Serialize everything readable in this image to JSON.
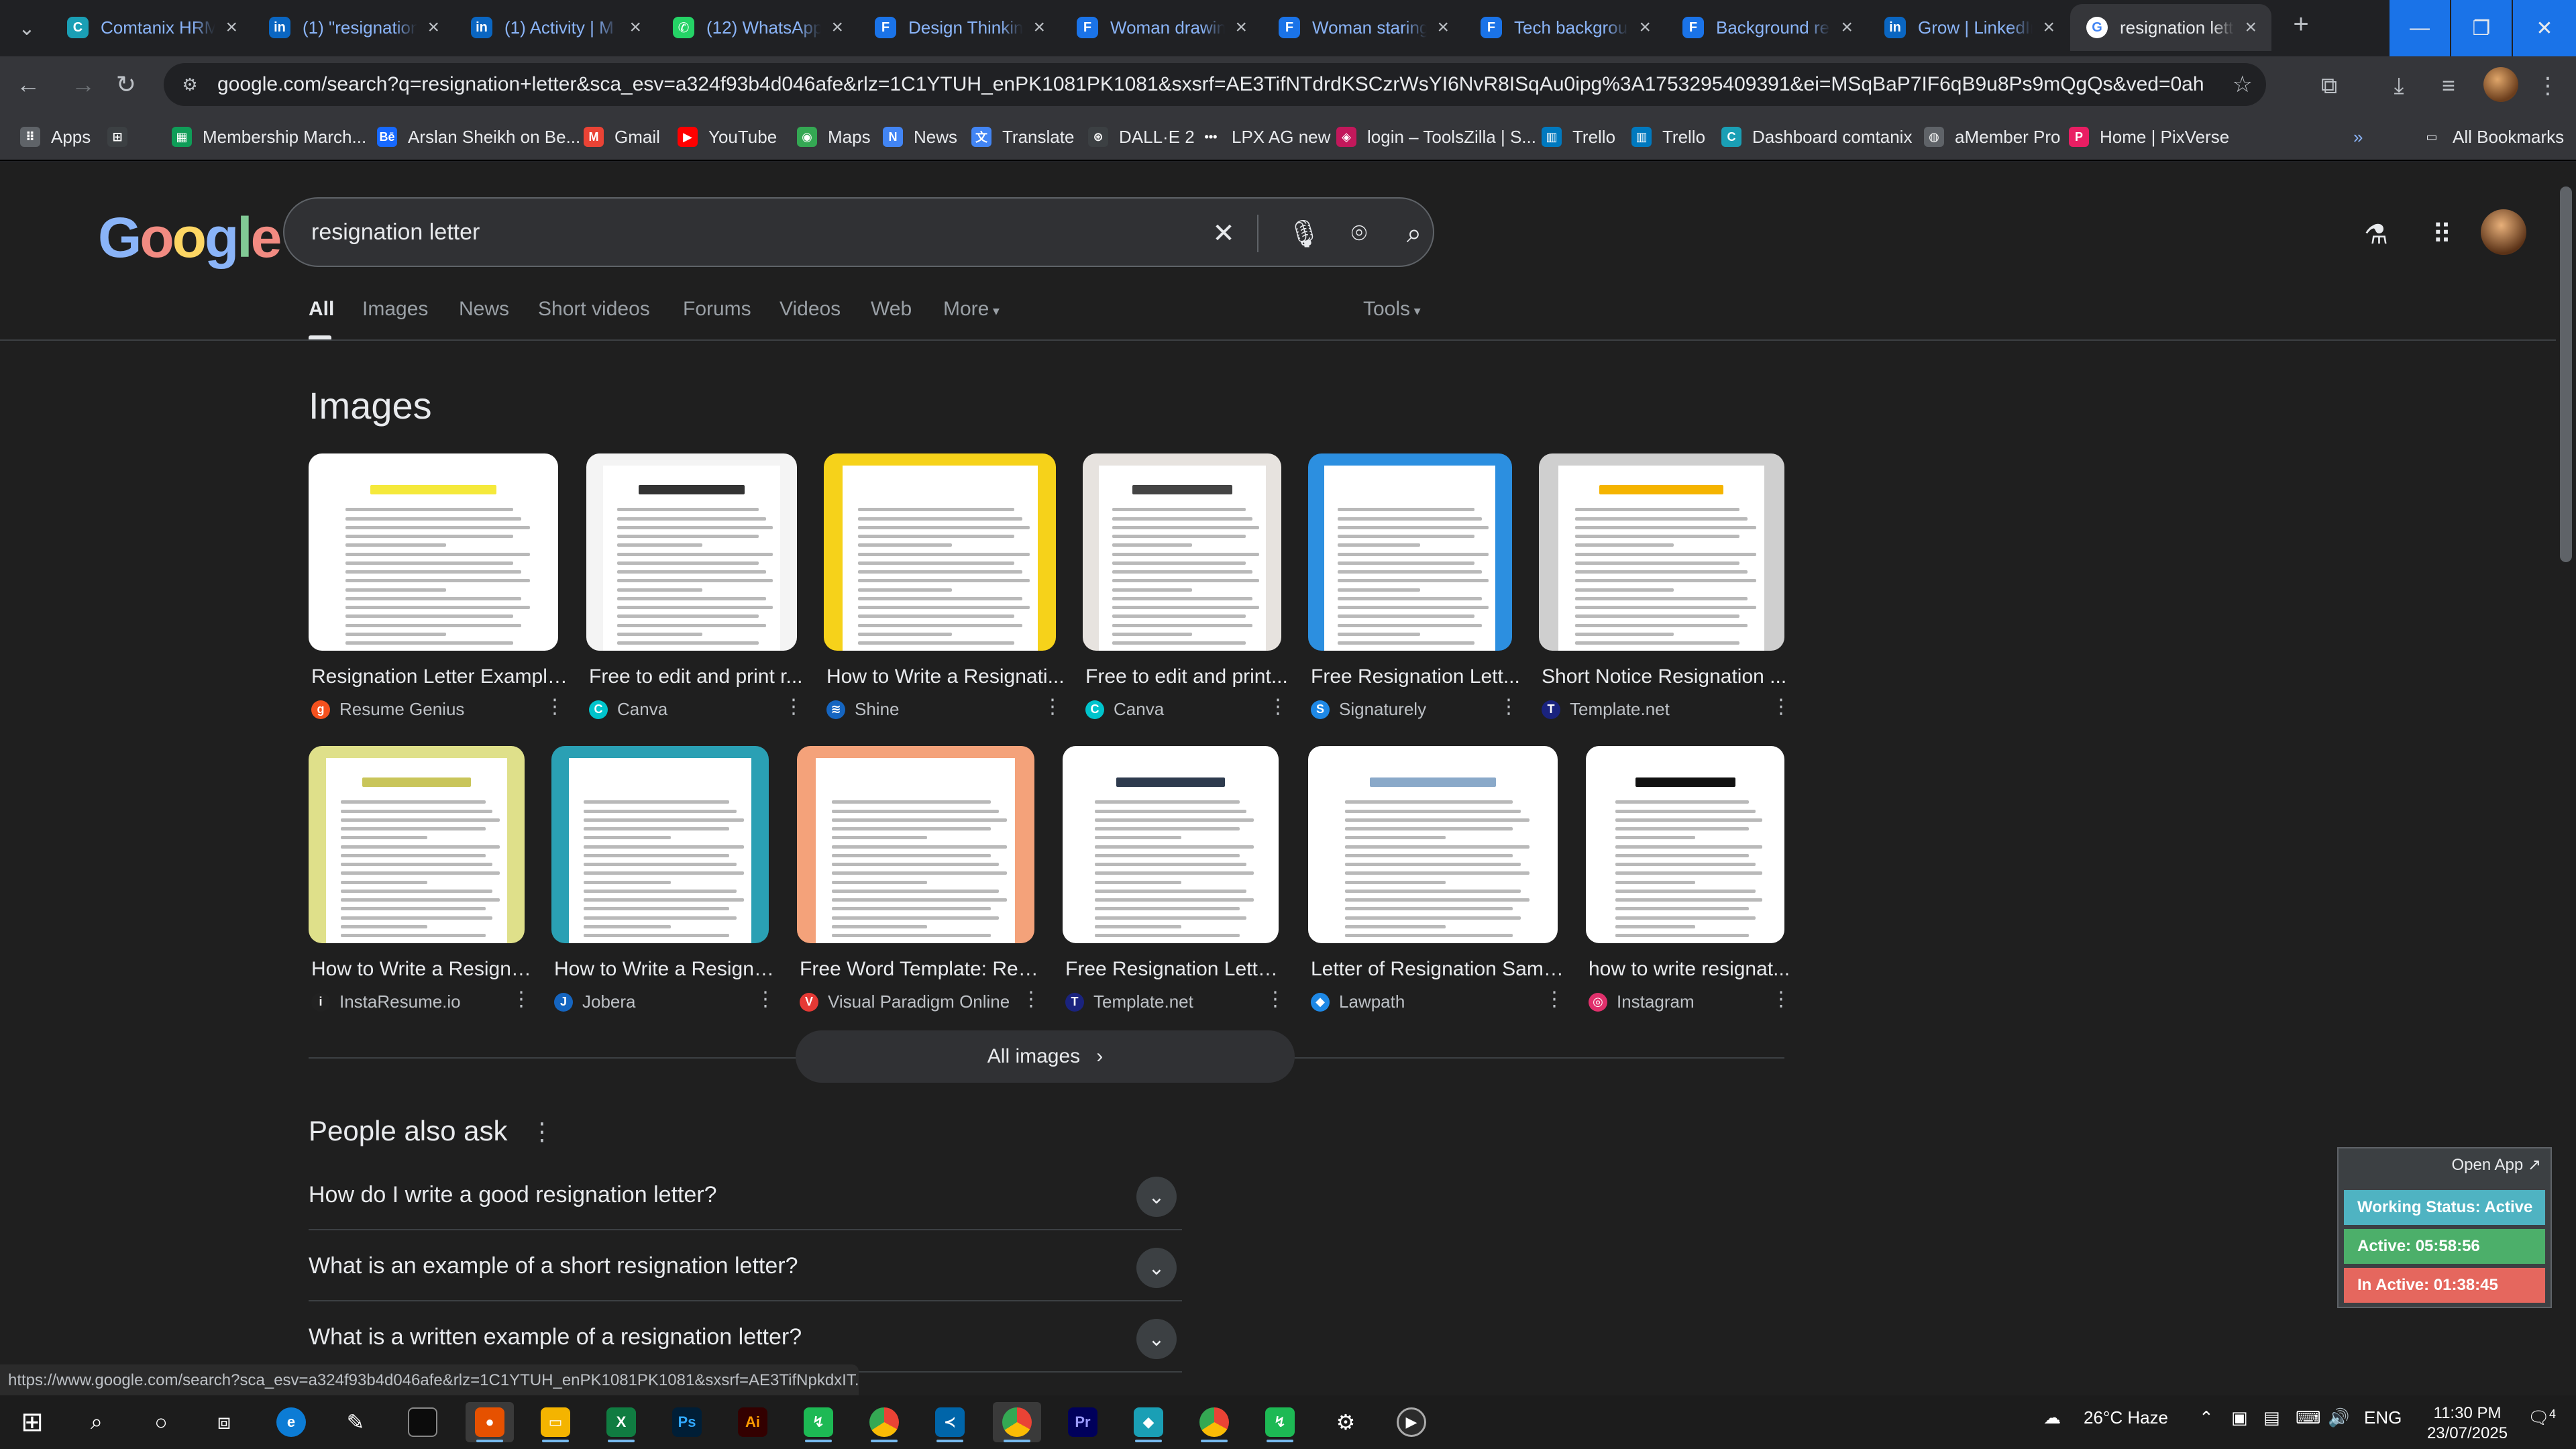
{
  "tabs": [
    {
      "title": "Comtanix HRM",
      "icon": "comtanix-icon",
      "color": "#1a9fb5",
      "glyph": "C"
    },
    {
      "title": "(1) \"resignation",
      "icon": "linkedin-icon",
      "color": "#0a66c2",
      "glyph": "in"
    },
    {
      "title": "(1) Activity | M",
      "icon": "linkedin-icon",
      "color": "#0a66c2",
      "glyph": "in"
    },
    {
      "title": "(12) WhatsApp",
      "icon": "whatsapp-icon",
      "color": "#25d366",
      "glyph": "✆"
    },
    {
      "title": "Design Thinkin",
      "icon": "framer-icon",
      "color": "#1a73e8",
      "glyph": "F"
    },
    {
      "title": "Woman drawin",
      "icon": "framer-icon",
      "color": "#1a73e8",
      "glyph": "F"
    },
    {
      "title": "Woman staring",
      "icon": "framer-icon",
      "color": "#1a73e8",
      "glyph": "F"
    },
    {
      "title": "Tech backgrou",
      "icon": "framer-icon",
      "color": "#1a73e8",
      "glyph": "F"
    },
    {
      "title": "Background re",
      "icon": "framer-icon",
      "color": "#1a73e8",
      "glyph": "F"
    },
    {
      "title": "Grow | LinkedIn",
      "icon": "linkedin-icon",
      "color": "#0a66c2",
      "glyph": "in"
    },
    {
      "title": "resignation lett",
      "icon": "google-icon",
      "color": "#ffffff",
      "glyph": "G",
      "active": true
    }
  ],
  "toolbar": {
    "url": "google.com/search?q=resignation+letter&sca_esv=a324f93b4d046afe&rlz=1C1YTUH_enPK1081PK1081&sxsrf=AE3TifNTdrdKSCzrWsYI6NvR8ISqAu0ipg%3A1753295409391&ei=MSqBaP7IF6qB9u8Ps9mQgQs&ved=0ahUKEwi-pcCwztOOAxWq..."
  },
  "bookmarks": [
    {
      "label": "Apps",
      "icon": "apps-grid-icon",
      "color": "#5f6368",
      "glyph": "⠿"
    },
    {
      "label": "",
      "icon": "grid-icon",
      "color": "#3c4043",
      "glyph": "⊞"
    },
    {
      "label": "Membership March...",
      "icon": "sheets-icon",
      "color": "#0f9d58",
      "glyph": "▦"
    },
    {
      "label": "Arslan Sheikh on Be...",
      "icon": "behance-icon",
      "color": "#1769ff",
      "glyph": "Bē"
    },
    {
      "label": "Gmail",
      "icon": "gmail-icon",
      "color": "#ea4335",
      "glyph": "M"
    },
    {
      "label": "YouTube",
      "icon": "youtube-icon",
      "color": "#ff0000",
      "glyph": "▶"
    },
    {
      "label": "Maps",
      "icon": "maps-icon",
      "color": "#34a853",
      "glyph": "◉"
    },
    {
      "label": "News",
      "icon": "news-icon",
      "color": "#4285f4",
      "glyph": "N"
    },
    {
      "label": "Translate",
      "icon": "translate-icon",
      "color": "#4285f4",
      "glyph": "文"
    },
    {
      "label": "DALL·E 2",
      "icon": "openai-icon",
      "color": "#3c4043",
      "glyph": "⊛"
    },
    {
      "label": "LPX AG new",
      "icon": "dots-icon",
      "color": "#35363a",
      "glyph": "•••"
    },
    {
      "label": "login – ToolsZilla | S...",
      "icon": "toolszilla-icon",
      "color": "#c2185b",
      "glyph": "◈"
    },
    {
      "label": "Trello",
      "icon": "trello-icon",
      "color": "#0079bf",
      "glyph": "▥"
    },
    {
      "label": "Trello",
      "icon": "trello-icon",
      "color": "#0079bf",
      "glyph": "▥"
    },
    {
      "label": "Dashboard comtanix",
      "icon": "comtanix-icon",
      "color": "#1a9fb5",
      "glyph": "C"
    },
    {
      "label": "aMember Pro",
      "icon": "globe-icon",
      "color": "#5f6368",
      "glyph": "◍"
    },
    {
      "label": "Home | PixVerse",
      "icon": "pixverse-icon",
      "color": "#e91e63",
      "glyph": "P"
    }
  ],
  "bookmarks_overflow": "»",
  "all_bookmarks": "All Bookmarks",
  "search": {
    "query": "resignation letter",
    "logo": [
      "G",
      "o",
      "o",
      "g",
      "l",
      "e"
    ]
  },
  "nav_tabs": [
    "All",
    "Images",
    "News",
    "Short videos",
    "Forums",
    "Videos",
    "Web",
    "More",
    "Tools"
  ],
  "images_heading": "Images",
  "images": [
    {
      "caption": "Resignation Letter Example...",
      "source": "Resume Genius",
      "src_color": "#f4511e",
      "src_glyph": "g",
      "thumb_bg": "#ffffff",
      "accent": "#f5e93b"
    },
    {
      "caption": "Free to edit and print r...",
      "source": "Canva",
      "src_color": "#00c4cc",
      "src_glyph": "C",
      "thumb_bg": "#f4f4f4",
      "accent": "#333333"
    },
    {
      "caption": "How to Write a Resignati...",
      "source": "Shine",
      "src_color": "#1565c0",
      "src_glyph": "≋",
      "thumb_bg": "#f6d21a",
      "accent": "#ffffff"
    },
    {
      "caption": "Free to edit and print...",
      "source": "Canva",
      "src_color": "#00c4cc",
      "src_glyph": "C",
      "thumb_bg": "#e7e3df",
      "accent": "#444444"
    },
    {
      "caption": "Free Resignation Lett...",
      "source": "Signaturely",
      "src_color": "#1e88e5",
      "src_glyph": "S",
      "thumb_bg": "#2c8fe0",
      "accent": "#ffffff"
    },
    {
      "caption": "Short Notice Resignation ...",
      "source": "Template.net",
      "src_color": "#1a237e",
      "src_glyph": "T",
      "thumb_bg": "#cfcfcf",
      "accent": "#f5b400"
    },
    {
      "caption": "How to Write a Resigna...",
      "source": "InstaResume.io",
      "src_color": "#212121",
      "src_glyph": "i",
      "thumb_bg": "#dfe08a",
      "accent": "#c9c55a"
    },
    {
      "caption": "How to Write a Resigna...",
      "source": "Jobera",
      "src_color": "#1565c0",
      "src_glyph": "J",
      "thumb_bg": "#2aa0b4",
      "accent": "#ffffff"
    },
    {
      "caption": "Free Word Template: Resi...",
      "source": "Visual Paradigm Online",
      "src_color": "#e53935",
      "src_glyph": "V",
      "thumb_bg": "#f4a27a",
      "accent": "#ffffff"
    },
    {
      "caption": "Free Resignation Letter...",
      "source": "Template.net",
      "src_color": "#1a237e",
      "src_glyph": "T",
      "thumb_bg": "#ffffff",
      "accent": "#2e3b4e"
    },
    {
      "caption": "Letter of Resignation Samp...",
      "source": "Lawpath",
      "src_color": "#1e88e5",
      "src_glyph": "◆",
      "thumb_bg": "#ffffff",
      "accent": "#8aa9c9"
    },
    {
      "caption": "how to write resignat...",
      "source": "Instagram",
      "src_color": "#e1306c",
      "src_glyph": "◎",
      "thumb_bg": "#ffffff",
      "accent": "#111111"
    }
  ],
  "all_images_label": "All images",
  "paa": {
    "heading": "People also ask",
    "questions": [
      "How do I write a good resignation letter?",
      "What is an example of a short resignation letter?",
      "What is a written example of a resignation letter?"
    ]
  },
  "widget": {
    "open_app": "Open App ↗",
    "status": "Working Status: Active",
    "active": "Active: 05:58:56",
    "inactive": "In Active: 01:38:45",
    "status_color": "#4fb3c2",
    "active_color": "#4caf6a",
    "inactive_color": "#e5675e"
  },
  "status_link": "https://www.google.com/search?sca_esv=a324f93b4d046afe&rlz=1C1YTUH_enPK1081PK1081&sxsrf=AE3TifNpkdxIT...",
  "taskbar": {
    "weather": "26°C Haze",
    "lang": "ENG",
    "time": "11:30 PM",
    "date": "23/07/2025",
    "notif_count": "4"
  }
}
